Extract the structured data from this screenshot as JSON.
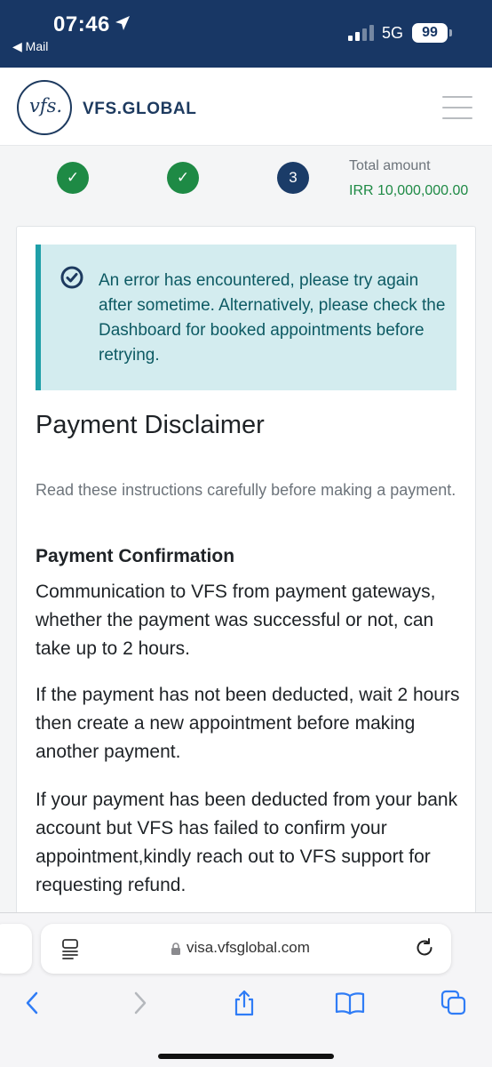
{
  "status_bar": {
    "time": "07:46",
    "back_app": "◀ Mail",
    "network": "5G",
    "battery": "99"
  },
  "header": {
    "logo_text": "vfs.",
    "brand": "VFS.GLOBAL"
  },
  "stepper": {
    "steps": [
      {
        "state": "done",
        "label": "✓"
      },
      {
        "state": "done",
        "label": "✓"
      },
      {
        "state": "current",
        "label": "3"
      }
    ],
    "total_label": "Total amount",
    "total_amount": "IRR 10,000,000.00"
  },
  "alert": {
    "message": "An error has encountered, please try again after sometime. Alternatively, please check the Dashboard for booked appointments before retrying."
  },
  "content": {
    "title": "Payment Disclaimer",
    "subtitle": "Read these instructions carefully before making a payment.",
    "section_heading": "Payment Confirmation",
    "paragraphs": [
      "Communication to VFS from payment gateways, whether the payment was successful or not, can take up to 2 hours.",
      "If the payment has not been deducted, wait 2 hours then create a new appointment before making another payment.",
      "If your payment has been deducted from your bank account but VFS has failed to confirm your appointment,kindly reach out to VFS support for requesting refund."
    ]
  },
  "browser": {
    "url": "visa.vfsglobal.com"
  },
  "colors": {
    "status_bar_bg": "#183765",
    "success_green": "#1e8a45",
    "step_current": "#1b3c68",
    "alert_bg": "#d3ecef",
    "alert_border": "#1f9fa8",
    "ios_blue": "#2f7cf6"
  },
  "icons": {
    "location": "location-arrow-icon",
    "signal": "cellular-signal-icon",
    "menu": "hamburger-menu-icon",
    "alert": "check-circle-icon",
    "reader": "reader-mode-icon",
    "lock": "lock-icon",
    "reload": "reload-icon",
    "back": "chevron-left-icon",
    "forward": "chevron-right-icon",
    "share": "share-icon",
    "bookmarks": "book-icon",
    "tabs": "tabs-icon"
  }
}
